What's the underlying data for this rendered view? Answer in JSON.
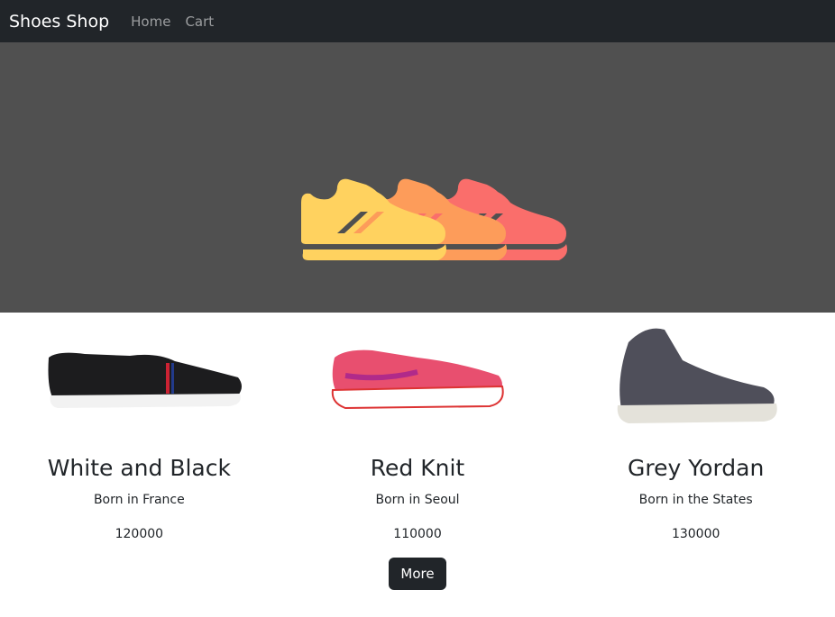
{
  "navbar": {
    "brand": "Shoes Shop",
    "links": [
      "Home",
      "Cart"
    ]
  },
  "hero": {
    "icon": "shoes-icon",
    "colors": [
      "#ffd25f",
      "#fd9c5a",
      "#fa6e6b"
    ],
    "background": "#505050"
  },
  "products": [
    {
      "title": "White and Black",
      "description": "Born in France",
      "price": "120000",
      "image": "black-sneaker"
    },
    {
      "title": "Red Knit",
      "description": "Born in Seoul",
      "price": "110000",
      "image": "pink-running-shoe"
    },
    {
      "title": "Grey Yordan",
      "description": "Born in the States",
      "price": "130000",
      "image": "grey-high-top"
    }
  ],
  "more_label": "More"
}
